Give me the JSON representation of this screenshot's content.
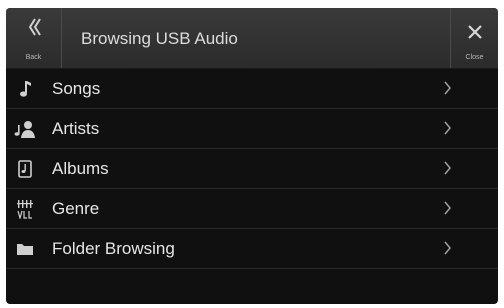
{
  "header": {
    "back_label": "Back",
    "title": "Browsing USB Audio",
    "close_label": "Close"
  },
  "menu": [
    {
      "label": "Songs",
      "icon": "music-note-icon"
    },
    {
      "label": "Artists",
      "icon": "artist-icon"
    },
    {
      "label": "Albums",
      "icon": "album-icon"
    },
    {
      "label": "Genre",
      "icon": "genre-icon"
    },
    {
      "label": "Folder Browsing",
      "icon": "folder-icon"
    }
  ],
  "colors": {
    "background": "#101010",
    "header": "#333333",
    "text": "#e6e6e6",
    "icon": "#cfcfcf"
  }
}
